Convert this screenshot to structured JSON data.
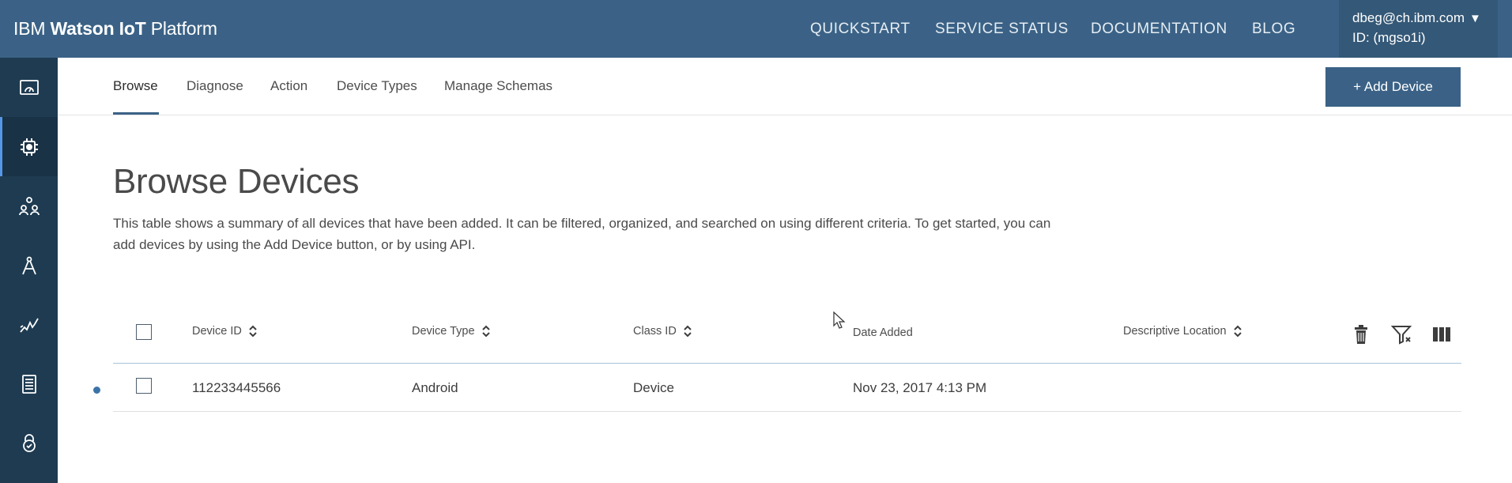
{
  "header": {
    "brand_prefix": "IBM ",
    "brand_bold": "Watson IoT",
    "brand_suffix": " Platform",
    "nav": [
      "QUICKSTART",
      "SERVICE STATUS",
      "DOCUMENTATION",
      "BLOG"
    ],
    "user_email": "dbeg@ch.ibm.com",
    "user_id": "ID: (mgso1i)",
    "caret": "▼"
  },
  "sidebar": {
    "items": [
      {
        "icon": "dashboard-icon"
      },
      {
        "icon": "chip-icon",
        "active": true
      },
      {
        "icon": "members-icon"
      },
      {
        "icon": "rules-icon"
      },
      {
        "icon": "usage-icon"
      },
      {
        "icon": "apps-icon"
      },
      {
        "icon": "security-icon"
      }
    ]
  },
  "tabs": [
    "Browse",
    "Diagnose",
    "Action",
    "Device Types",
    "Manage Schemas"
  ],
  "active_tab": "Browse",
  "add_device_label": "+ Add Device",
  "page": {
    "title": "Browse Devices",
    "description": "This table shows a summary of all devices that have been added. It can be filtered, organized, and searched on using different criteria. To get started, you can add devices by using the Add Device button, or by using API."
  },
  "table": {
    "columns": [
      "Device ID",
      "Device Type",
      "Class ID",
      "Date Added",
      "Descriptive Location"
    ],
    "rows": [
      {
        "device_id": "112233445566",
        "device_type": "Android",
        "class_id": "Device",
        "date_added": "Nov 23, 2017 4:13 PM",
        "location": ""
      }
    ],
    "toolbar_icons": [
      "trash-icon",
      "filter-icon",
      "columns-icon"
    ]
  },
  "colors": {
    "topbar": "#3b6286",
    "sidebar": "#1e3b51",
    "accent": "#3b6286"
  }
}
